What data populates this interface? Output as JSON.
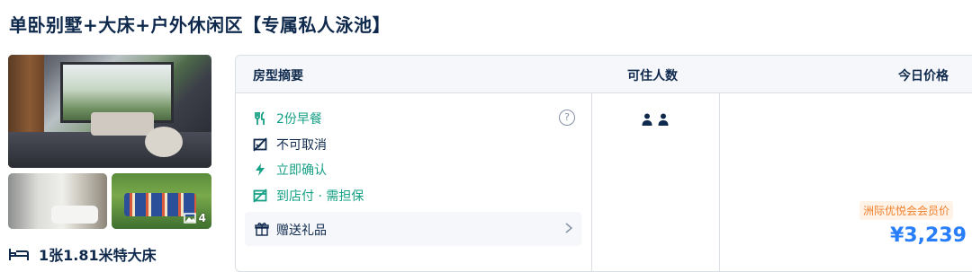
{
  "room": {
    "title": "单卧别墅+大床+户外休闲区【专属私人泳池】",
    "photo_count": "4",
    "bed": "1张1.81米特大床"
  },
  "table": {
    "headers": {
      "summary": "房型摘要",
      "occupancy": "可住人数",
      "price": "今日价格"
    },
    "features": [
      {
        "icon": "utensils-icon",
        "label": "2份早餐"
      },
      {
        "icon": "no-cancel-icon",
        "label": "不可取消"
      },
      {
        "icon": "lightning-icon",
        "label": "立即确认"
      },
      {
        "icon": "pay-at-hotel-icon",
        "label": "到店付 · 需担保"
      }
    ],
    "gift": {
      "icon": "gift-icon",
      "label": "赠送礼品"
    },
    "occupancy_count": 2,
    "member_tag": "洲际优悦会会员价",
    "price": "¥3,239"
  },
  "colors": {
    "accent_blue": "#287dfa",
    "teal": "#16a085",
    "orange": "#f17f2b",
    "text_dark": "#0f294d"
  }
}
